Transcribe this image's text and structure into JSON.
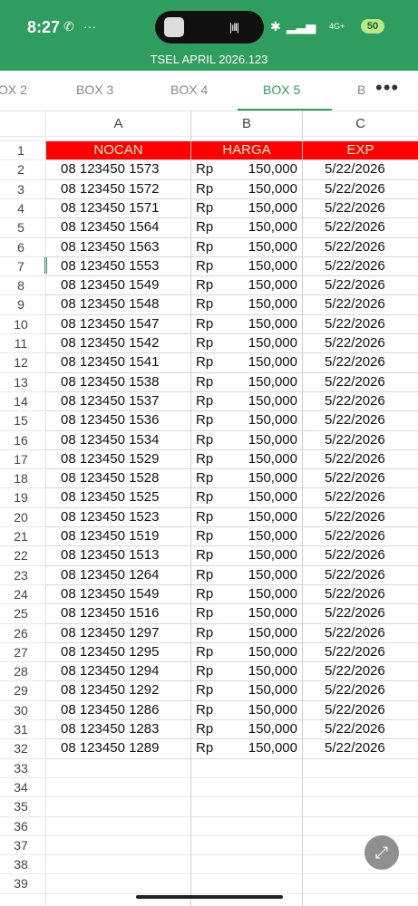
{
  "status_bar": {
    "time": "8:27",
    "battery": "50",
    "network": "4G+"
  },
  "file_title": "TSEL APRIL 2026.123",
  "tabs": [
    "OX 2",
    "BOX 3",
    "BOX 4",
    "BOX 5",
    "B"
  ],
  "active_tab": "BOX 5",
  "more_label": "•••",
  "columns": [
    "A",
    "B",
    "C"
  ],
  "header": {
    "nocan": "NOCAN",
    "harga": "HARGA",
    "exp": "EXP"
  },
  "header_color": "#ff0000",
  "accent_color": "#2e9d5f",
  "rows": [
    {
      "num": "08 123450 1573",
      "cur": "Rp",
      "price": "150,000",
      "exp": "5/22/2026"
    },
    {
      "num": "08 123450 1572",
      "cur": "Rp",
      "price": "150,000",
      "exp": "5/22/2026"
    },
    {
      "num": "08 123450 1571",
      "cur": "Rp",
      "price": "150,000",
      "exp": "5/22/2026"
    },
    {
      "num": "08 123450 1564",
      "cur": "Rp",
      "price": "150,000",
      "exp": "5/22/2026"
    },
    {
      "num": "08 123450 1563",
      "cur": "Rp",
      "price": "150,000",
      "exp": "5/22/2026"
    },
    {
      "num": "08 123450 1553",
      "cur": "Rp",
      "price": "150,000",
      "exp": "5/22/2026"
    },
    {
      "num": "08 123450 1549",
      "cur": "Rp",
      "price": "150,000",
      "exp": "5/22/2026"
    },
    {
      "num": "08 123450 1548",
      "cur": "Rp",
      "price": "150,000",
      "exp": "5/22/2026"
    },
    {
      "num": "08 123450 1547",
      "cur": "Rp",
      "price": "150,000",
      "exp": "5/22/2026"
    },
    {
      "num": "08 123450 1542",
      "cur": "Rp",
      "price": "150,000",
      "exp": "5/22/2026"
    },
    {
      "num": "08 123450 1541",
      "cur": "Rp",
      "price": "150,000",
      "exp": "5/22/2026"
    },
    {
      "num": "08 123450 1538",
      "cur": "Rp",
      "price": "150,000",
      "exp": "5/22/2026"
    },
    {
      "num": "08 123450 1537",
      "cur": "Rp",
      "price": "150,000",
      "exp": "5/22/2026"
    },
    {
      "num": "08 123450 1536",
      "cur": "Rp",
      "price": "150,000",
      "exp": "5/22/2026"
    },
    {
      "num": "08 123450 1534",
      "cur": "Rp",
      "price": "150,000",
      "exp": "5/22/2026"
    },
    {
      "num": "08 123450 1529",
      "cur": "Rp",
      "price": "150,000",
      "exp": "5/22/2026"
    },
    {
      "num": "08 123450 1528",
      "cur": "Rp",
      "price": "150,000",
      "exp": "5/22/2026"
    },
    {
      "num": "08 123450 1525",
      "cur": "Rp",
      "price": "150,000",
      "exp": "5/22/2026"
    },
    {
      "num": "08 123450 1523",
      "cur": "Rp",
      "price": "150,000",
      "exp": "5/22/2026"
    },
    {
      "num": "08 123450 1519",
      "cur": "Rp",
      "price": "150,000",
      "exp": "5/22/2026"
    },
    {
      "num": "08 123450 1513",
      "cur": "Rp",
      "price": "150,000",
      "exp": "5/22/2026"
    },
    {
      "num": "08 123450 1264",
      "cur": "Rp",
      "price": "150,000",
      "exp": "5/22/2026"
    },
    {
      "num": "08 123450 1549",
      "cur": "Rp",
      "price": "150,000",
      "exp": "5/22/2026"
    },
    {
      "num": "08 123450 1516",
      "cur": "Rp",
      "price": "150,000",
      "exp": "5/22/2026"
    },
    {
      "num": "08 123450 1297",
      "cur": "Rp",
      "price": "150,000",
      "exp": "5/22/2026"
    },
    {
      "num": "08 123450 1295",
      "cur": "Rp",
      "price": "150,000",
      "exp": "5/22/2026"
    },
    {
      "num": "08 123450 1294",
      "cur": "Rp",
      "price": "150,000",
      "exp": "5/22/2026"
    },
    {
      "num": "08 123450 1292",
      "cur": "Rp",
      "price": "150,000",
      "exp": "5/22/2026"
    },
    {
      "num": "08 123450 1286",
      "cur": "Rp",
      "price": "150,000",
      "exp": "5/22/2026"
    },
    {
      "num": "08 123450 1283",
      "cur": "Rp",
      "price": "150,000",
      "exp": "5/22/2026"
    },
    {
      "num": "08 123450 1289",
      "cur": "Rp",
      "price": "150,000",
      "exp": "5/22/2026"
    }
  ],
  "row_numbers": [
    "1",
    "2",
    "3",
    "4",
    "5",
    "6",
    "7",
    "8",
    "9",
    "10",
    "11",
    "12",
    "13",
    "14",
    "15",
    "16",
    "17",
    "18",
    "19",
    "20",
    "21",
    "22",
    "23",
    "24",
    "25",
    "26",
    "27",
    "28",
    "29",
    "30",
    "31",
    "32",
    "33",
    "34",
    "35",
    "36",
    "37",
    "38",
    "39"
  ]
}
